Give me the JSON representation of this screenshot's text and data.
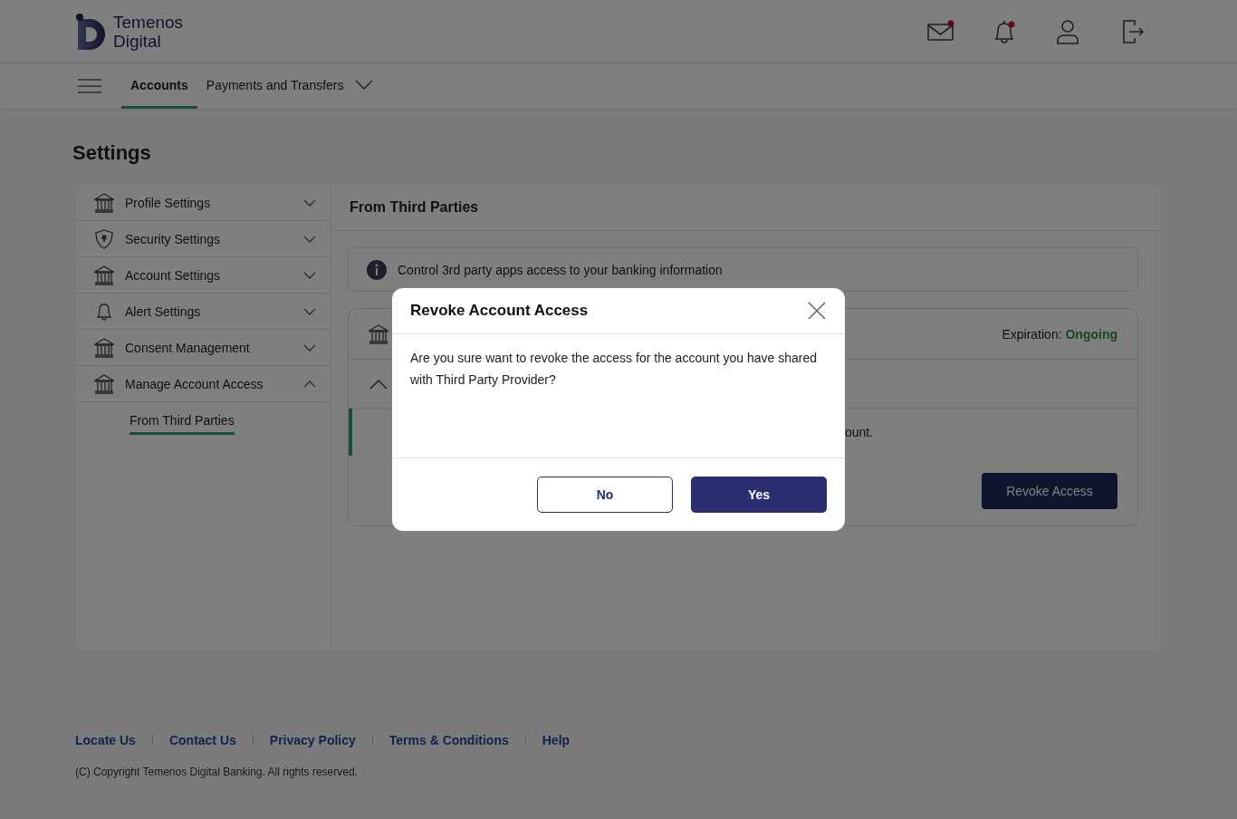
{
  "brand": {
    "line1": "Temenos",
    "line2": "Digital"
  },
  "header_icons": [
    {
      "kind": "mail",
      "badge": true
    },
    {
      "kind": "bell",
      "badge": true
    },
    {
      "kind": "user",
      "badge": false
    },
    {
      "kind": "logout",
      "badge": false
    }
  ],
  "nav": {
    "tabs": [
      {
        "label": "Accounts",
        "selected": true,
        "dropdown": false
      },
      {
        "label": "Payments and Transfers",
        "selected": false,
        "dropdown": true
      }
    ]
  },
  "page_title": "Settings",
  "sidebar": {
    "items": [
      {
        "label": "Profile Settings",
        "kind": "bank",
        "expanded": false
      },
      {
        "label": "Security Settings",
        "kind": "shield",
        "expanded": false
      },
      {
        "label": "Account Settings",
        "kind": "bank",
        "expanded": false
      },
      {
        "label": "Alert Settings",
        "kind": "bell",
        "expanded": false
      },
      {
        "label": "Consent Management",
        "kind": "bank",
        "expanded": false
      },
      {
        "label": "Manage Account Access",
        "kind": "bank",
        "expanded": true,
        "children": [
          {
            "label": "From Third Parties",
            "selected": true
          }
        ]
      }
    ]
  },
  "panel": {
    "title": "From Third Parties",
    "info": "Control 3rd party apps access to your banking information",
    "account": {
      "expiration_label": "Expiration:",
      "expiration_value": "Ongoing",
      "expanded": true,
      "detail_text": "ount.",
      "revoke_button": "Revoke Access"
    }
  },
  "dialog": {
    "title": "Revoke Account Access",
    "message": "Are you sure want to revoke the access for the account you have shared with Third Party Provider?",
    "buttons": [
      {
        "label": "No",
        "kind": "secondary"
      },
      {
        "label": "Yes",
        "kind": "primary"
      }
    ]
  },
  "footer": {
    "links": [
      "Locate Us",
      "Contact Us",
      "Privacy Policy",
      "Terms & Conditions",
      "Help"
    ],
    "copyright": "(C) Copyright Temenos Digital Banking. All rights reserved."
  }
}
